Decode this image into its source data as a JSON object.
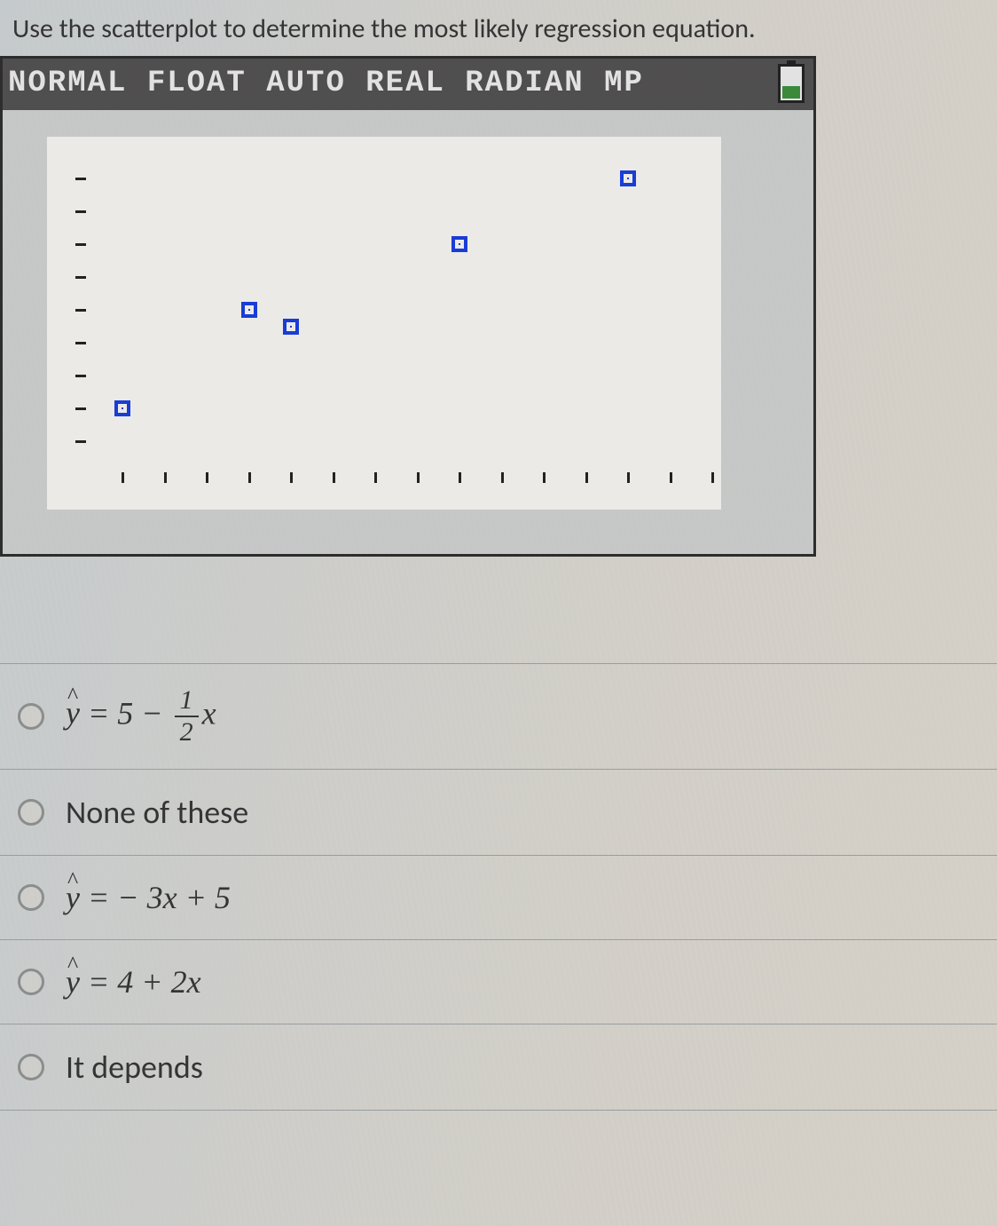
{
  "question": "Use the scatterplot to determine the most likely regression equation.",
  "calculator": {
    "header": "NORMAL FLOAT AUTO REAL RADIAN MP",
    "battery_icon": "battery-low-icon"
  },
  "chart_data": {
    "type": "scatter",
    "title": "",
    "xlabel": "",
    "ylabel": "",
    "xlim": [
      0,
      15
    ],
    "ylim": [
      0,
      10
    ],
    "points": [
      {
        "x": 1,
        "y": 2
      },
      {
        "x": 4,
        "y": 5
      },
      {
        "x": 5,
        "y": 4.5
      },
      {
        "x": 9,
        "y": 7
      },
      {
        "x": 13,
        "y": 9
      }
    ]
  },
  "options": [
    {
      "id": "opt1",
      "type": "equation",
      "display": "ŷ = 5 − (1/2)x",
      "intercept": 5,
      "slope": -0.5
    },
    {
      "id": "opt2",
      "type": "text",
      "display": "None of these"
    },
    {
      "id": "opt3",
      "type": "equation",
      "display": "ŷ = −3x + 5",
      "intercept": 5,
      "slope": -3
    },
    {
      "id": "opt4",
      "type": "equation",
      "display": "ŷ = 4 + 2x",
      "intercept": 4,
      "slope": 2
    },
    {
      "id": "opt5",
      "type": "text",
      "display": "It depends"
    }
  ]
}
